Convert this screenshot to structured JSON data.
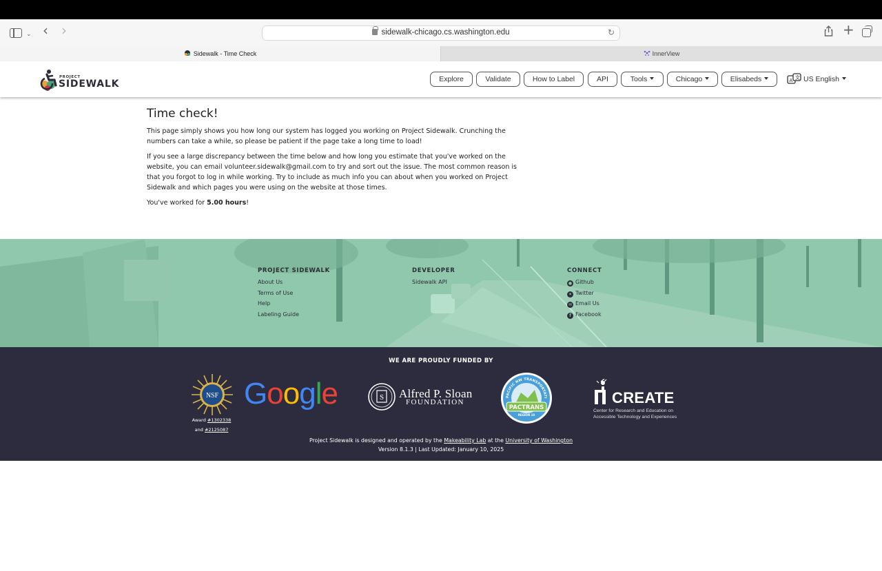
{
  "browser": {
    "url": "sidewalk-chicago.cs.washington.edu",
    "tabs": [
      {
        "label": "Sidewalk - Time Check",
        "active": true
      },
      {
        "label": "InnerView",
        "active": false
      }
    ]
  },
  "navbar": {
    "logo_small": "PROJECT",
    "logo_large": "SIDEWALK",
    "buttons": [
      "Explore",
      "Validate",
      "How to Label",
      "API"
    ],
    "dropdowns": [
      "Tools",
      "Chicago",
      "Elisabeds"
    ],
    "language": "US English"
  },
  "main": {
    "title": "Time check!",
    "para1": "This page simply shows you how long our system has logged you working on Project Sidewalk. Crunching the numbers can take a while, so please be patient if the page take a long time to load!",
    "para2": "If you see a large discrepancy between the time below and how long you estimate that you've worked on the website, you can email volunteer.sidewalk@gmail.com to try and sort out the issue. The most common reason is that you forgot to log in while working. Try to include as much info you can about when you worked on Project Sidewalk and which pages you were using on the website at those times.",
    "worked_prefix": "You've worked for ",
    "worked_value": "5.00 hours",
    "worked_suffix": "!"
  },
  "footer": {
    "columns": [
      {
        "heading": "PROJECT SIDEWALK",
        "links": [
          "About Us",
          "Terms of Use",
          "Help",
          "Labeling Guide"
        ]
      },
      {
        "heading": "DEVELOPER",
        "links": [
          "Sidewalk API"
        ]
      },
      {
        "heading": "CONNECT",
        "links": [
          "Github",
          "Twitter",
          "Email Us",
          "Facebook"
        ]
      }
    ],
    "funded_title": "WE ARE PROUDLY FUNDED BY",
    "nsf": {
      "logo_text": "NSF",
      "award_prefix": "Award ",
      "award1": "#1302338",
      "and_prefix": "and ",
      "award2": "#2125087"
    },
    "google": "Google",
    "sloan": {
      "name": "Alfred P. Sloan",
      "sub": "FOUNDATION"
    },
    "pactrans": {
      "arc_text": "PACIFIC NW TRANSPORTATION CONSORTIUM",
      "banner": "PACTRANS",
      "region": "REGION 10"
    },
    "create": {
      "name": "CREATE",
      "subtitle": "Center for Research and Education on Accessible Technology and Experiences"
    },
    "credits": {
      "prefix": "Project Sidewalk is designed and operated by the ",
      "lab": "Makeability Lab",
      "middle": " at the ",
      "university": "University of Washington",
      "version": "Version 8.1.3 | Last Updated: January 10, 2025"
    }
  },
  "colors": {
    "footer_green": "#8cc5a8",
    "footer_dark": "#2c2c3e"
  }
}
